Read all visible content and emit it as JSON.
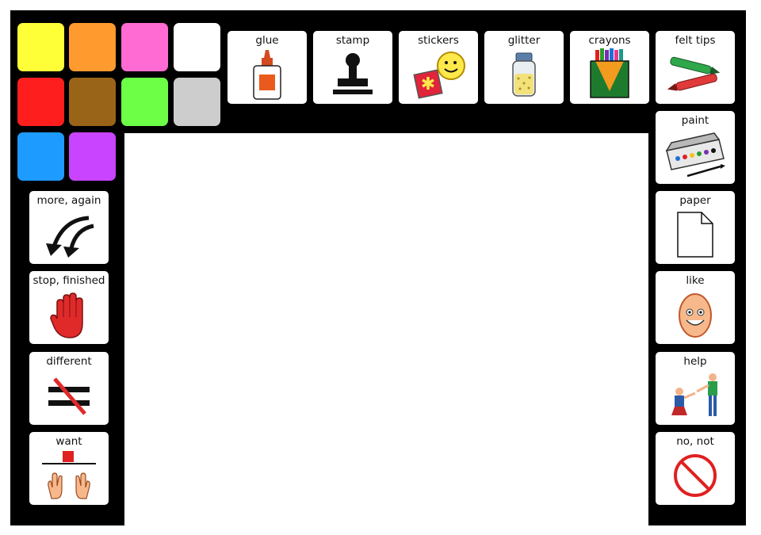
{
  "palette": {
    "colors": [
      "#FFFF38",
      "#FF9A2E",
      "#FF6BD2",
      "#FFFFFF",
      "#FF1E1E",
      "#9A6418",
      "#6CFF46",
      "#CDCDCD",
      "#1E9BFF",
      "#C944FF"
    ]
  },
  "toolbar": {
    "glue": "glue",
    "stamp": "stamp",
    "stickers": "stickers",
    "glitter": "glitter",
    "crayons": "crayons",
    "felt_tips": "felt tips"
  },
  "right_column": {
    "paint": "paint",
    "paper": "paper",
    "like": "like",
    "help": "help",
    "no_not": "no, not"
  },
  "left_column": {
    "more_again": "more, again",
    "stop_finished": "stop, finished",
    "different": "different",
    "want": "want"
  },
  "icons": {
    "glue": "glue-bottle-icon",
    "stamp": "rubber-stamp-icon",
    "stickers": "stickers-icon",
    "glitter": "glitter-jar-icon",
    "crayons": "crayon-box-icon",
    "felt_tips": "felt-tip-pens-icon",
    "paint": "paint-palette-icon",
    "paper": "paper-sheet-icon",
    "like": "smiling-face-icon",
    "help": "helping-people-icon",
    "no_not": "prohibited-icon",
    "more_again": "repeat-arrows-icon",
    "stop_finished": "stop-hand-icon",
    "different": "not-equal-icon",
    "want": "want-hands-icon"
  }
}
